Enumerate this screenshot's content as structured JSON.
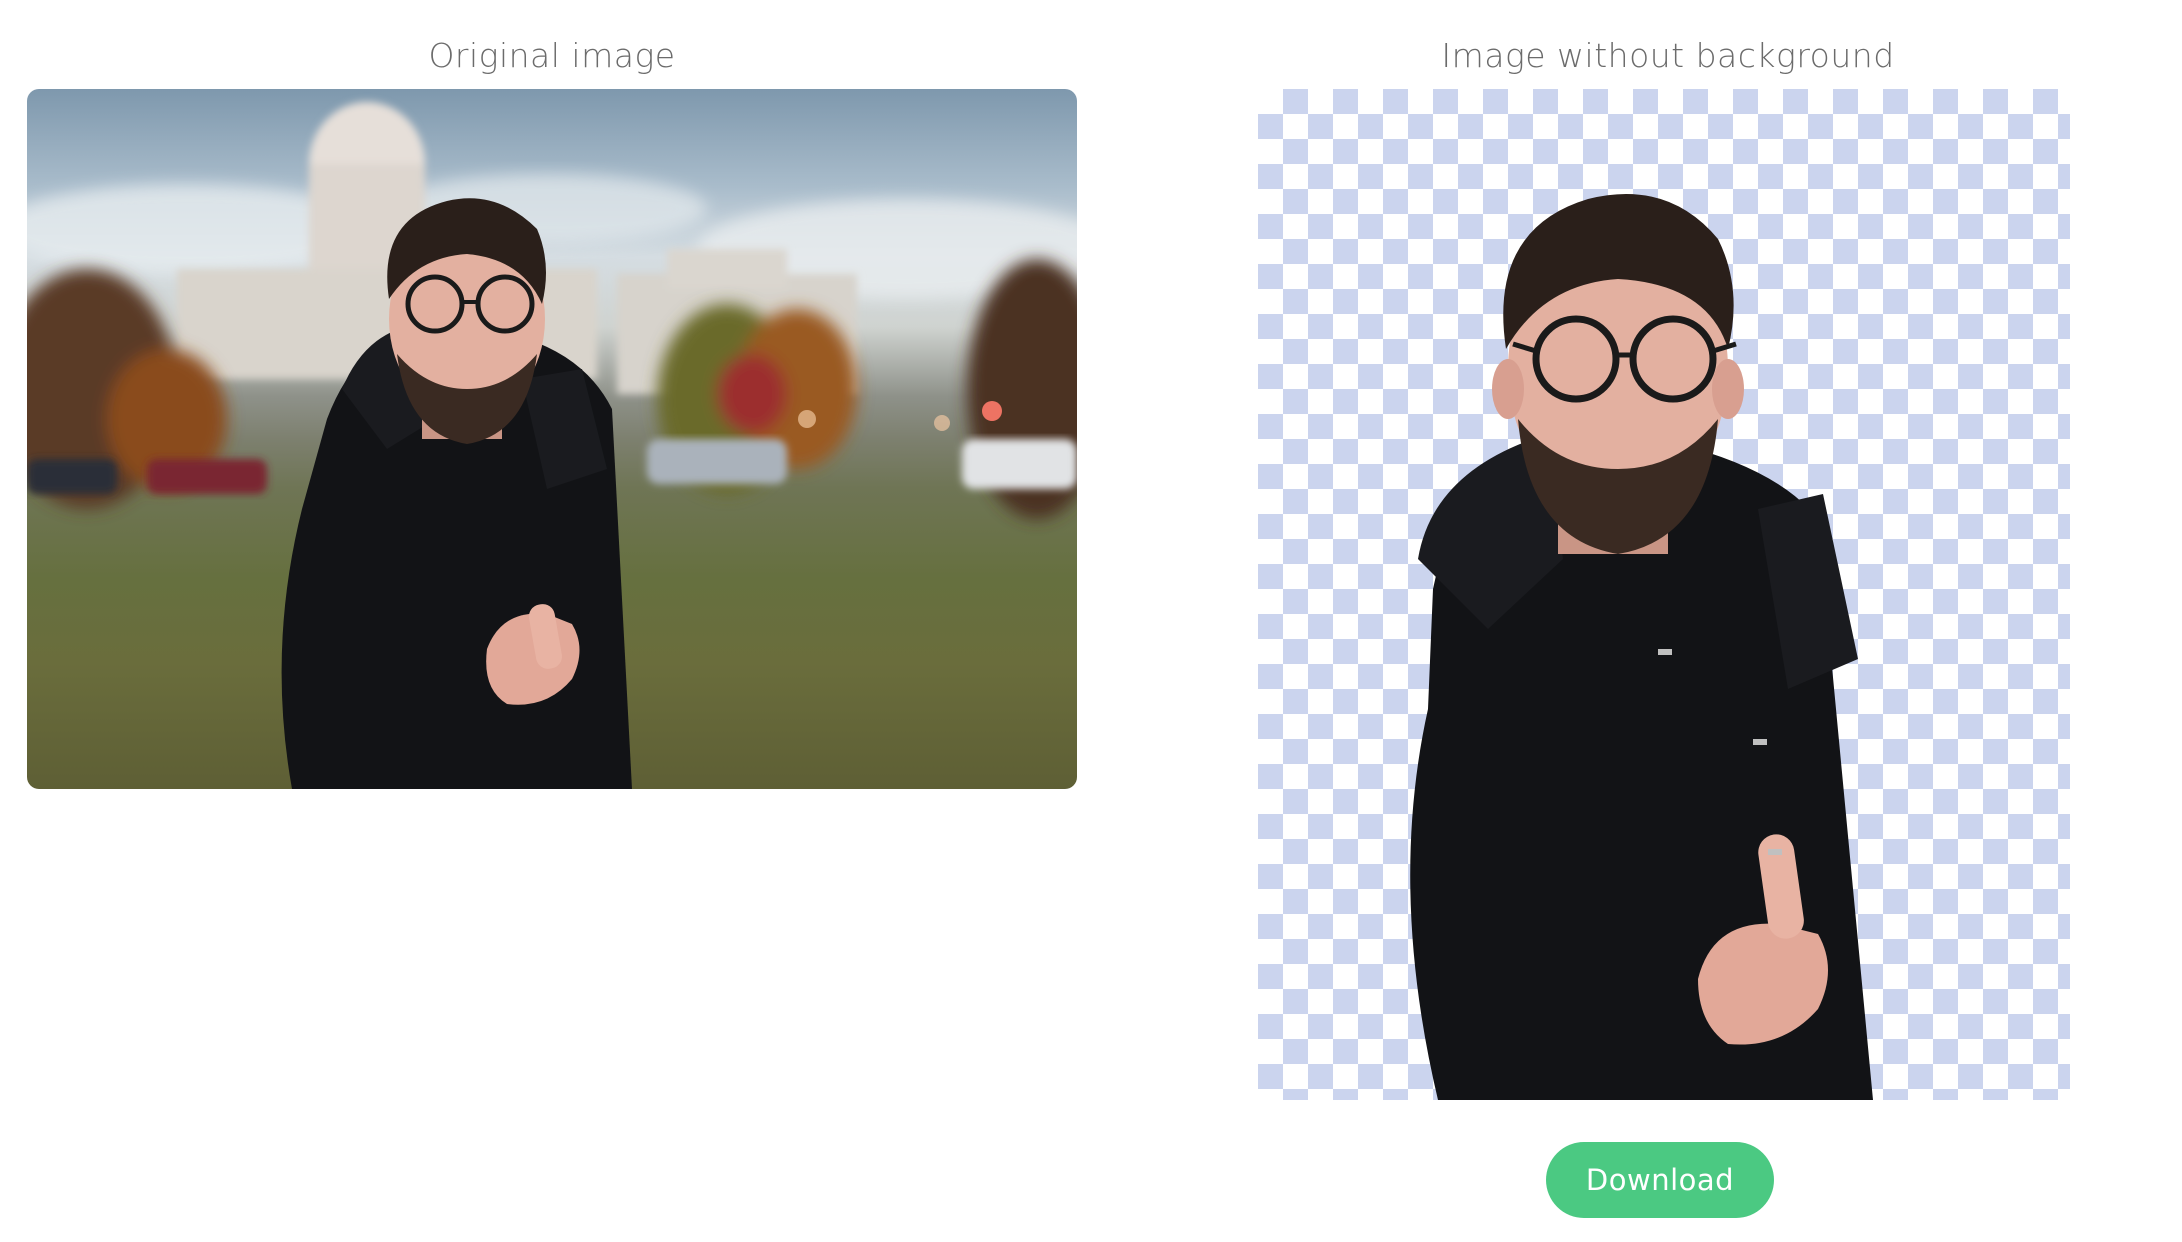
{
  "original": {
    "title": "Original image",
    "photo_icon": "photo-of-man-pointing"
  },
  "result": {
    "title": "Image without background",
    "photo_icon": "cutout-of-man-pointing"
  },
  "actions": {
    "download_label": "Download"
  },
  "colors": {
    "accent": "#4bc982",
    "checker": "#cbd4ee",
    "title_text": "#6b6b6b"
  }
}
